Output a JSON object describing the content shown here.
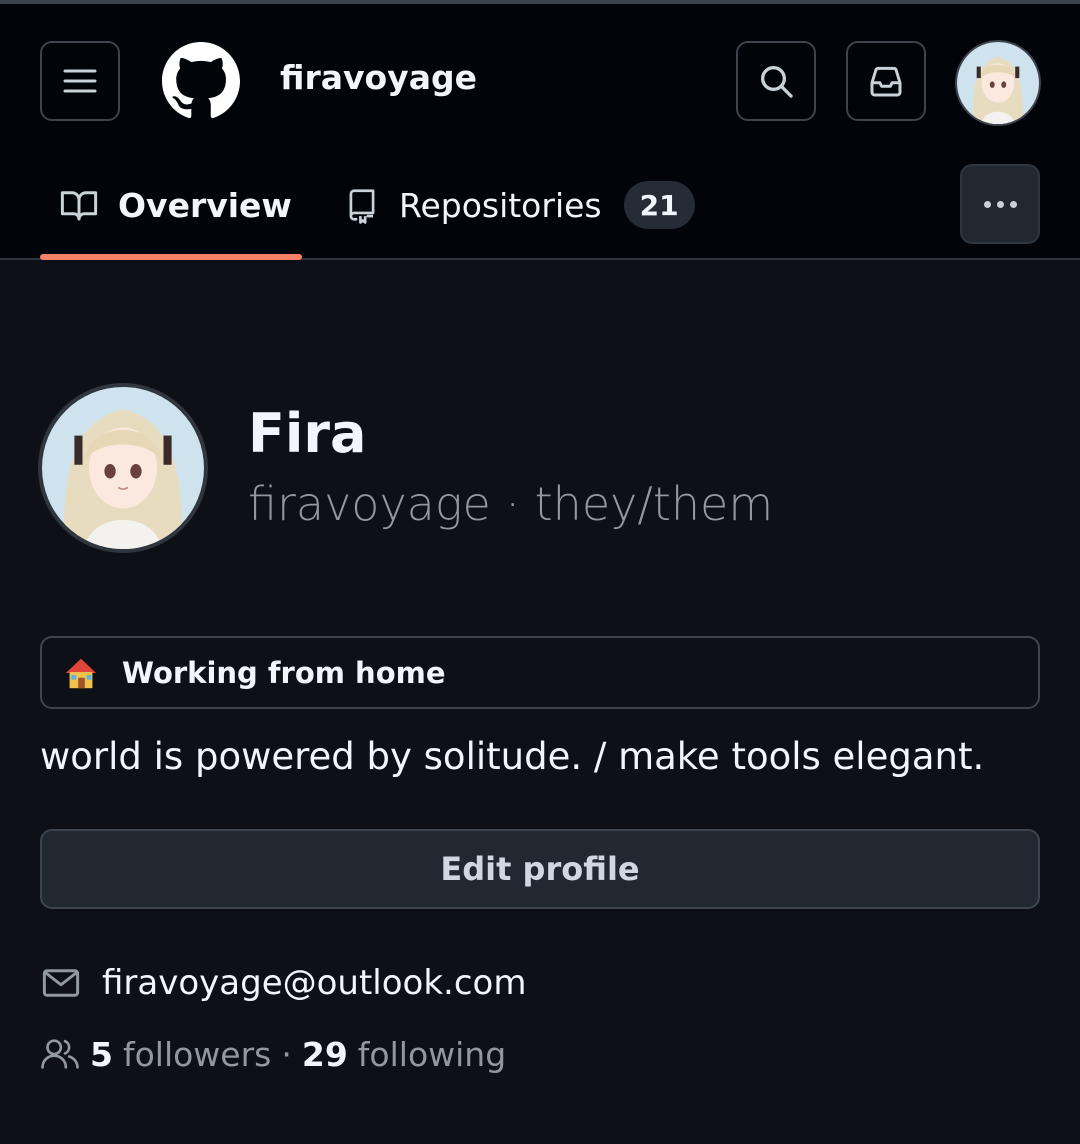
{
  "header": {
    "username": "firavoyage",
    "menu_icon": "hamburger-icon",
    "logo_icon": "github-mark-icon",
    "search_icon": "search-icon",
    "inbox_icon": "inbox-icon"
  },
  "tabs": [
    {
      "label": "Overview",
      "icon": "book-icon",
      "active": true
    },
    {
      "label": "Repositories",
      "icon": "repo-icon",
      "count": "21"
    }
  ],
  "more_icon": "kebab-horizontal-icon",
  "profile": {
    "name": "Fira",
    "login_line": "firavoyage · they/them",
    "status_emoji": "house-icon",
    "status_text": "Working from home",
    "bio": "world is powered by solitude. / make tools elegant.",
    "edit_label": "Edit profile",
    "email": "firavoyage@outlook.com",
    "followers_count": "5",
    "followers_label": "followers",
    "separator": "·",
    "following_count": "29",
    "following_label": "following"
  },
  "colors": {
    "background": "#0d1117",
    "header_bg": "#010409",
    "accent_underline": "#f78166",
    "muted_text": "#9198a1"
  }
}
